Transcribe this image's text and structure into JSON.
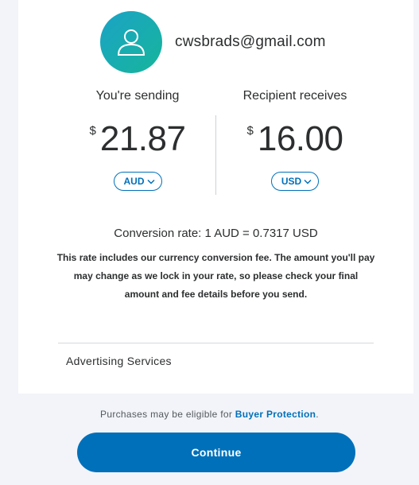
{
  "recipient": {
    "email": "cwsbrads@gmail.com",
    "avatar_icon": "user-icon"
  },
  "sending": {
    "label": "You're sending",
    "currency_symbol": "$",
    "amount": "21.87",
    "currency": "AUD"
  },
  "receiving": {
    "label": "Recipient receives",
    "currency_symbol": "$",
    "amount": "16.00",
    "currency": "USD"
  },
  "conversion": {
    "rate_text": "Conversion rate: 1 AUD = 0.7317 USD",
    "note": "This rate includes our currency conversion fee. The amount you'll pay may change as we lock in your rate, so please check your final amount and fee details before you send."
  },
  "advertising": {
    "label": "Advertising Services"
  },
  "footer": {
    "protection_prefix": "Purchases may be eligible for ",
    "protection_link": "Buyer Protection",
    "protection_suffix": "."
  },
  "actions": {
    "continue_label": "Continue"
  },
  "colors": {
    "accent": "#0070ba",
    "avatar_gradient_start": "#1ba3c6",
    "avatar_gradient_end": "#16b59b",
    "background": "#f2f4f9"
  }
}
